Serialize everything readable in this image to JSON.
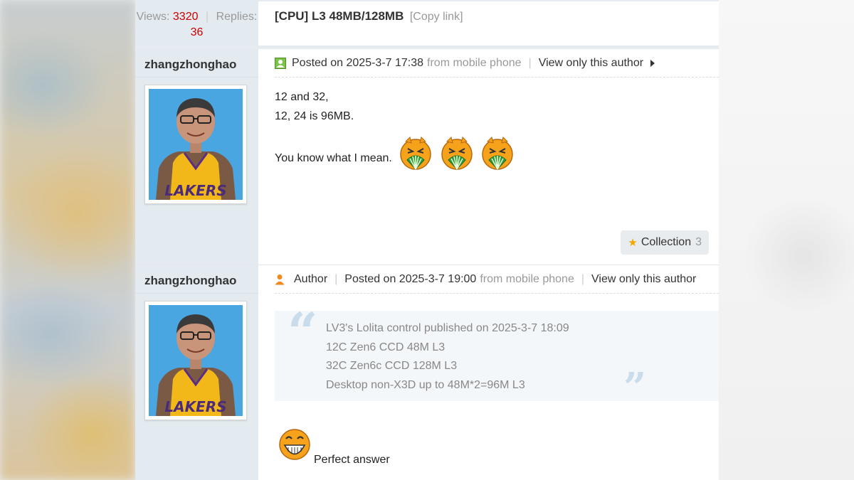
{
  "thread": {
    "views_label": "Views:",
    "views": "3320",
    "replies_label": "Replies:",
    "replies": "36",
    "title": "[CPU] L3 48MB/128MB",
    "copy_link": "[Copy link]"
  },
  "posts": [
    {
      "author": "zhangzhonghao",
      "posted": "Posted on 2025-3-7 17:38",
      "source": "from mobile phone",
      "view_only": "View only this author",
      "lines": [
        "12 and 32,",
        "12, 24 is 96MB.",
        "You know what I mean."
      ],
      "collection_label": "Collection",
      "collection_count": "3"
    },
    {
      "author": "zhangzhonghao",
      "author_badge": "Author",
      "posted": "Posted on 2025-3-7 19:00",
      "source": "from mobile phone",
      "view_only": "View only this author",
      "quote_lines": [
        "LV3's Lolita control published on 2025-3-7 18:09",
        "12C Zen6 CCD 48M L3",
        "32C Zen6c CCD 128M L3",
        "Desktop non-X3D up to 48M*2=96M L3"
      ],
      "reply_text": "Perfect answer"
    }
  ],
  "avatar_jersey_text": "LAKERS",
  "colors": {
    "count_red": "#cc0000",
    "muted": "#999999",
    "quote_bg": "#f4f7f9",
    "star": "#f0a800"
  },
  "icons": [
    "online-status-icon",
    "play-triangle-icon",
    "fan-laugh-smiley-icon",
    "star-icon",
    "author-person-icon",
    "quote-open-icon",
    "quote-close-icon",
    "grin-smiley-icon"
  ]
}
